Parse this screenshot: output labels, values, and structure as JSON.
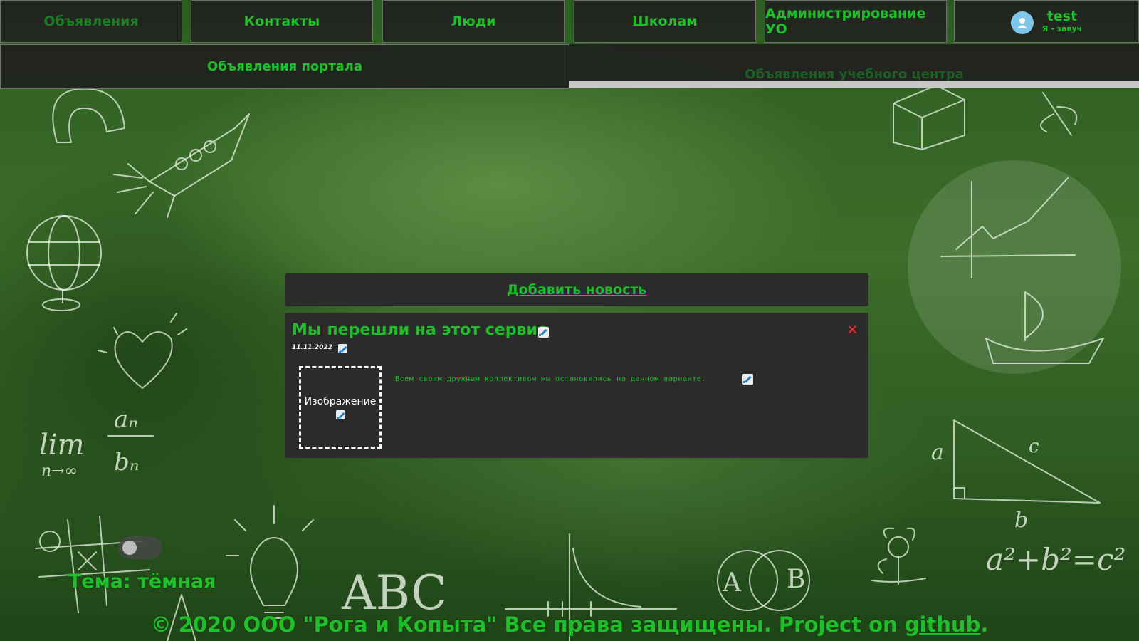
{
  "nav": {
    "tabs": [
      {
        "label": "Объявления"
      },
      {
        "label": "Контакты"
      },
      {
        "label": "Люди"
      },
      {
        "label": "Школам"
      },
      {
        "label": "Администрирование УО"
      }
    ],
    "user": {
      "name": "test",
      "role": "Я - завуч"
    }
  },
  "subnav": {
    "portal": "Объявления портала",
    "center": "Объявления учебного центра"
  },
  "add_news": {
    "label": "Добавить новость"
  },
  "news": [
    {
      "title": "Мы перешли на этот сервис",
      "date": "11.11.2022",
      "image_placeholder": "Изображение",
      "body": "Всем своим дружным коллективом мы остановились на данном варианте."
    }
  ],
  "theme": {
    "label": "Тема: тёмная",
    "dark": true
  },
  "footer": {
    "text": "© 2020 ООО \"Рога и Копыта\" Все права защищены. Project on ",
    "link": "github",
    "end": "."
  },
  "colors": {
    "accent": "#1fbf2a",
    "panel": "#2b2b2b",
    "close": "#e03030"
  }
}
